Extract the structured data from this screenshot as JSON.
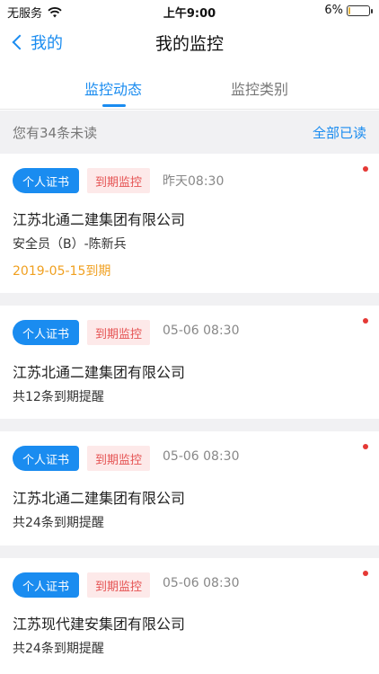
{
  "status_bar": {
    "carrier": "无服务",
    "time": "上午9:00",
    "battery_pct": "6%",
    "battery_level": 0.06
  },
  "nav": {
    "back_label": "我的",
    "title": "我的监控"
  },
  "tabs": [
    {
      "label": "监控动态",
      "active": true
    },
    {
      "label": "监控类别",
      "active": false
    }
  ],
  "unread": {
    "text": "您有34条未读",
    "mark_all": "全部已读"
  },
  "cards": [
    {
      "cert_badge": "个人证书",
      "type_badge": "到期监控",
      "time": "昨天08:30",
      "company": "江苏北通二建集团有限公司",
      "line2": "安全员（B）-陈新兵",
      "line3": "2019-05-15到期",
      "unread": true
    },
    {
      "cert_badge": "个人证书",
      "type_badge": "到期监控",
      "time": "05-06 08:30",
      "company": "江苏北通二建集团有限公司",
      "line2": "共12条到期提醒",
      "unread": true
    },
    {
      "cert_badge": "个人证书",
      "type_badge": "到期监控",
      "time": "05-06 08:30",
      "company": "江苏北通二建集团有限公司",
      "line2": "共24条到期提醒",
      "unread": true
    },
    {
      "cert_badge": "个人证书",
      "type_badge": "到期监控",
      "time": "05-06 08:30",
      "company": "江苏现代建安集团有限公司",
      "line2": "共24条到期提醒",
      "unread": true
    }
  ],
  "colors": {
    "accent": "#1a8cf0",
    "warning": "#f0a020",
    "badge_red": "#e55353",
    "dot": "#e53935"
  }
}
